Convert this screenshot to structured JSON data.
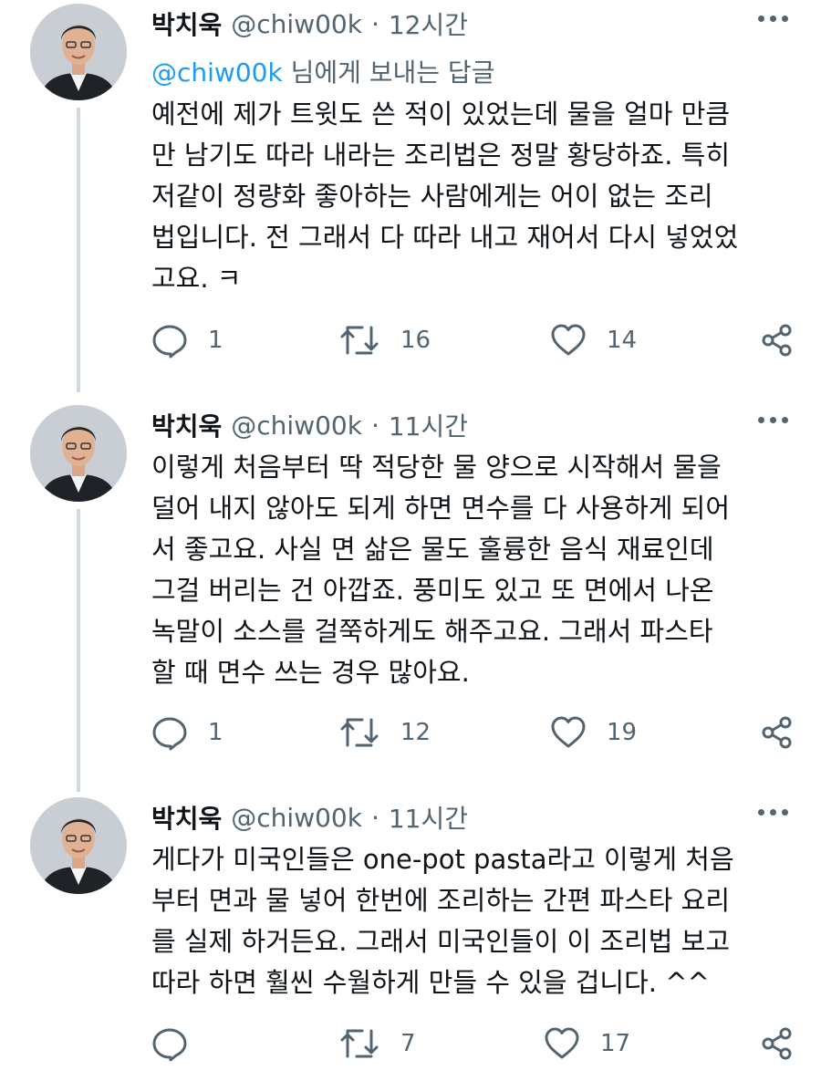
{
  "colors": {
    "accent": "#1d9bf0",
    "secondary_text": "#536471",
    "primary_text": "#0f1419",
    "thread_line": "#cfd9de"
  },
  "tweets": [
    {
      "author_name": "박치욱",
      "author_handle": "@chiw00k",
      "separator": "·",
      "time": "12시간",
      "reply_mention": "@chiw00k",
      "reply_suffix": " 님에게 보내는 답글",
      "body_lines": [
        "예전에 제가 트윗도 쓴 적이 있었는데 물을 얼마 만큼",
        "만 남기도 따라 내라는 조리법은 정말 황당하죠. 특히",
        "저같이 정량화 좋아하는 사람에게는 어이 없는 조리",
        "법입니다. 전 그래서 다 따라 내고 재어서 다시 넣었었",
        "고요. ㅋ"
      ],
      "reply_count": "1",
      "retweet_count": "16",
      "like_count": "14",
      "icons": [
        "reply-icon",
        "retweet-icon",
        "heart-icon",
        "share-icon",
        "more-icon"
      ]
    },
    {
      "author_name": "박치욱",
      "author_handle": "@chiw00k",
      "separator": "·",
      "time": "11시간",
      "body_lines": [
        "이렇게 처음부터 딱 적당한 물 양으로 시작해서 물을",
        "덜어 내지 않아도 되게 하면 면수를 다 사용하게 되어",
        "서 좋고요. 사실 면 삶은 물도 훌륭한 음식 재료인데",
        "그걸 버리는 건 아깝죠. 풍미도 있고 또 면에서 나온",
        "녹말이 소스를 걸쭉하게도 해주고요. 그래서 파스타",
        "할 때 면수 쓰는 경우 많아요."
      ],
      "reply_count": "1",
      "retweet_count": "12",
      "like_count": "19",
      "icons": [
        "reply-icon",
        "retweet-icon",
        "heart-icon",
        "share-icon",
        "more-icon"
      ]
    },
    {
      "author_name": "박치욱",
      "author_handle": "@chiw00k",
      "separator": "·",
      "time": "11시간",
      "body_lines": [
        "게다가 미국인들은 one-pot pasta라고 이렇게 처음",
        "부터 면과 물 넣어 한번에 조리하는 간편 파스타 요리",
        "를 실제 하거든요. 그래서 미국인들이 이 조리법 보고",
        "따라 하면 훨씬 수월하게 만들 수 있을 겁니다. ^^"
      ],
      "reply_count": "",
      "retweet_count": "7",
      "like_count": "17",
      "icons": [
        "reply-icon",
        "retweet-icon",
        "heart-icon",
        "share-icon",
        "more-icon"
      ]
    }
  ]
}
